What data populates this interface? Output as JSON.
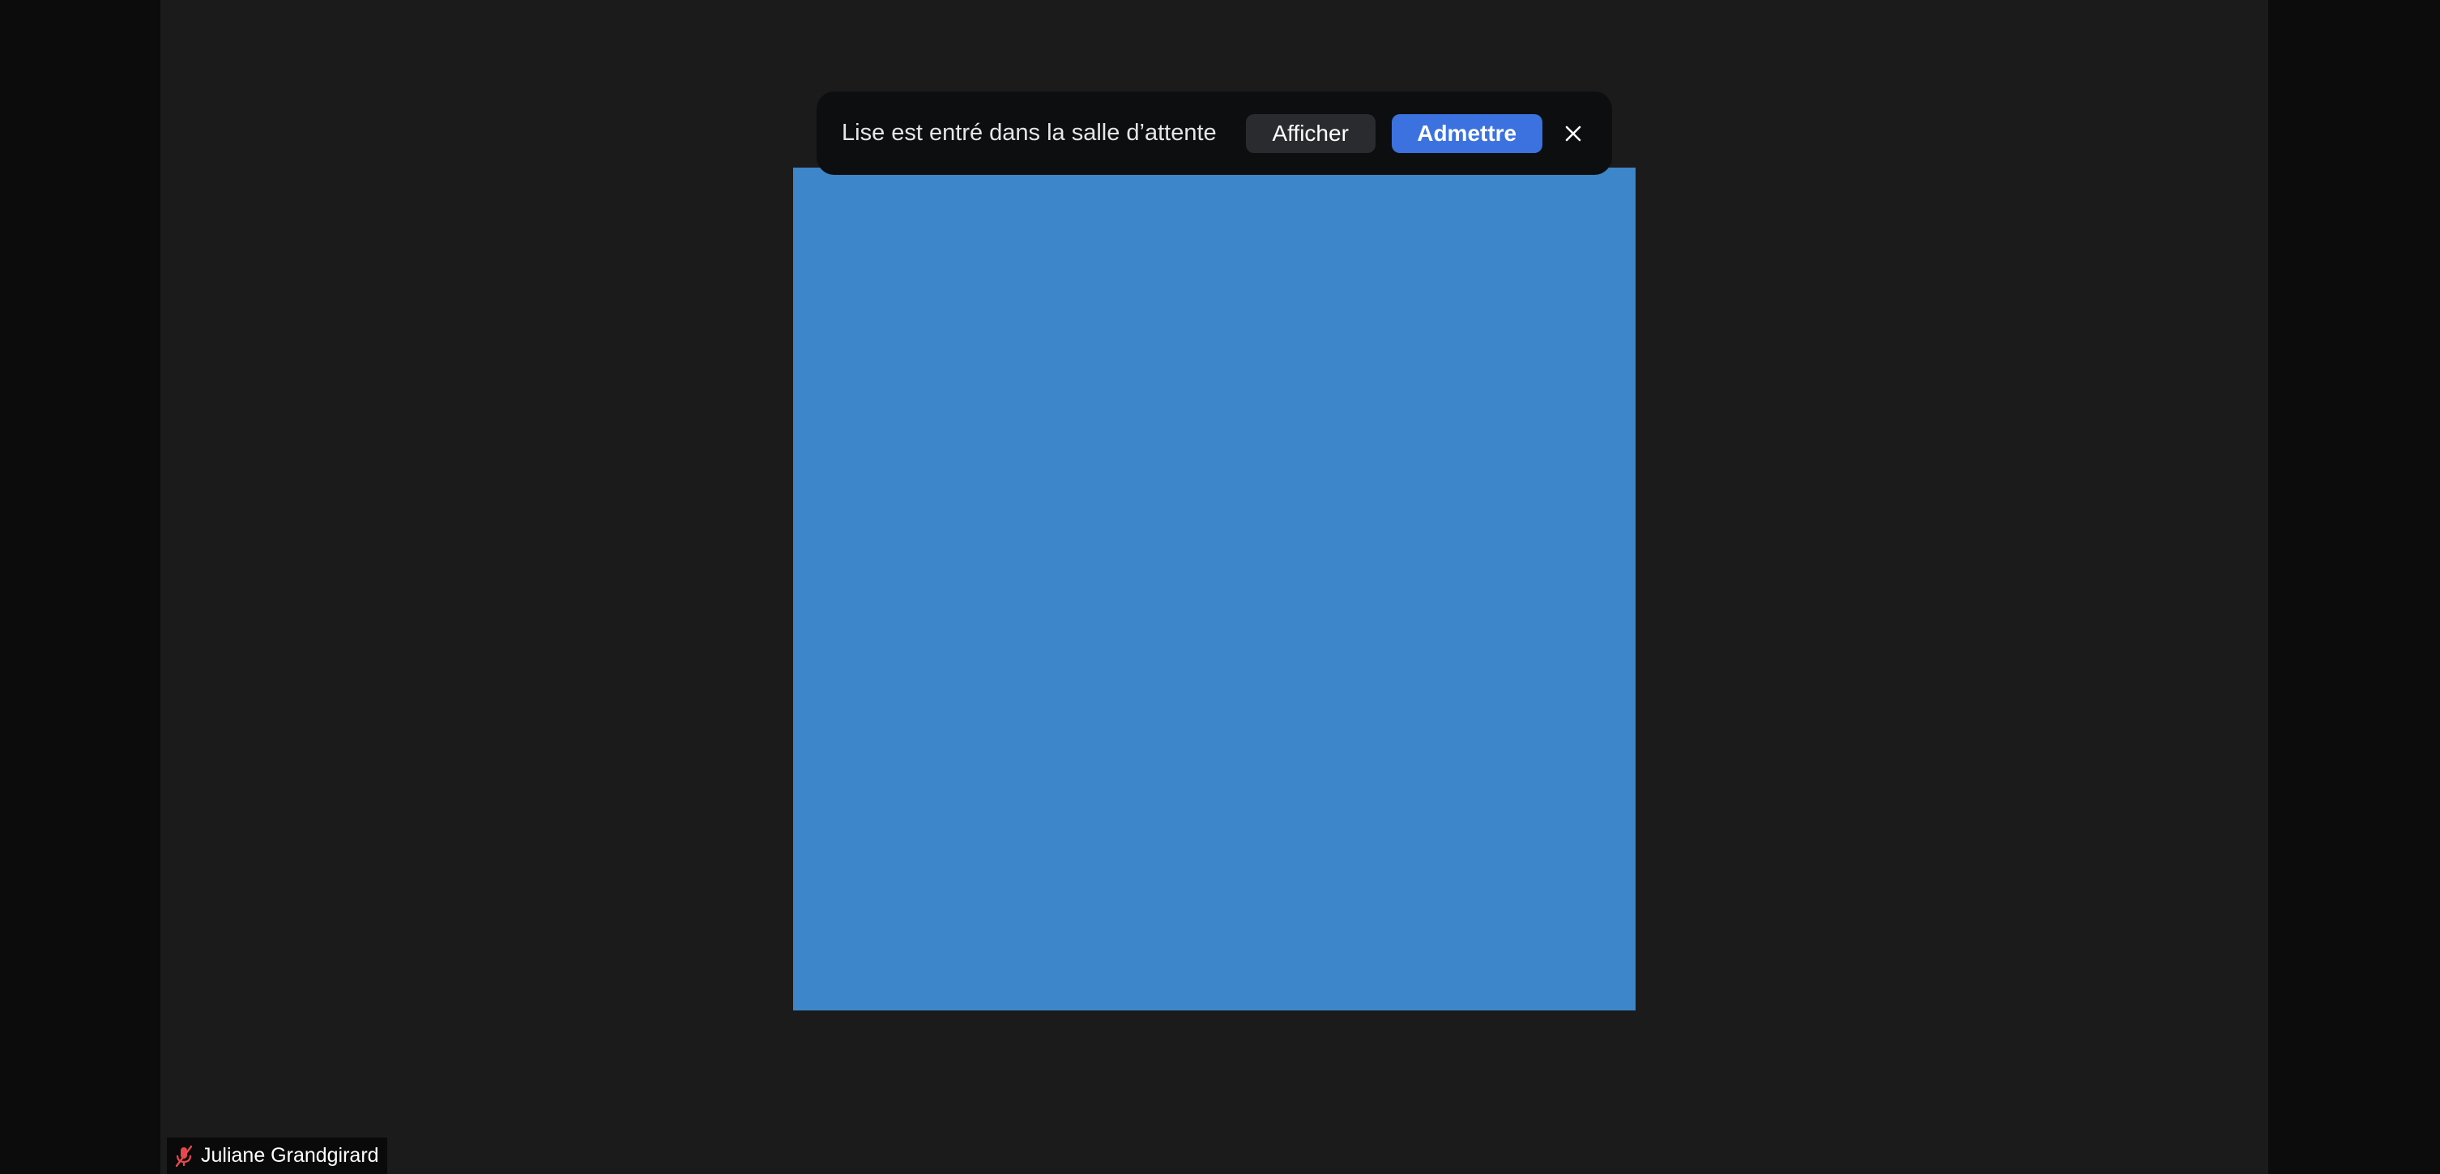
{
  "notification": {
    "message": "Lise est entré dans la salle d’attente",
    "view_label": "Afficher",
    "admit_label": "Admettre",
    "close_icon": "close-icon"
  },
  "participant": {
    "name": "Juliane Grandgirard",
    "mic_icon": "mic-muted-icon",
    "tile_color": "#3c86c9"
  },
  "colors": {
    "accent": "#3b72e0",
    "muted_icon": "#e5484d",
    "background": "#1b1b1b"
  }
}
